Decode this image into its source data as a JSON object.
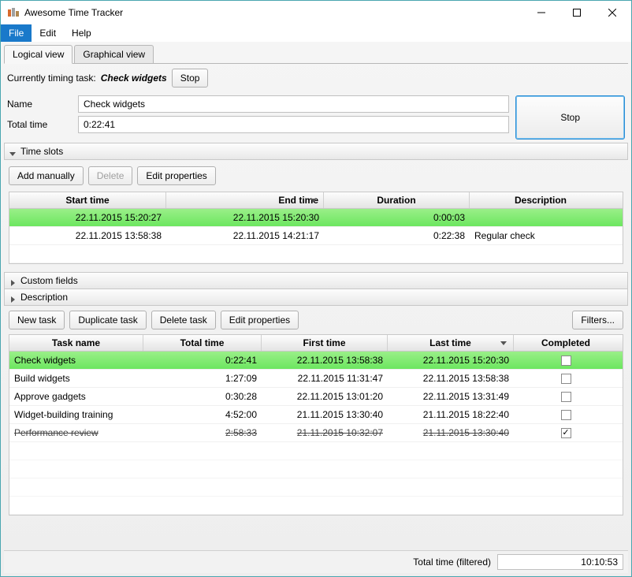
{
  "window": {
    "title": "Awesome Time Tracker"
  },
  "menubar": {
    "items": [
      {
        "label": "File",
        "active": true
      },
      {
        "label": "Edit",
        "active": false
      },
      {
        "label": "Help",
        "active": false
      }
    ]
  },
  "tabs": {
    "items": [
      {
        "label": "Logical view",
        "active": true
      },
      {
        "label": "Graphical view",
        "active": false
      }
    ]
  },
  "timing": {
    "prefix": "Currently timing task:",
    "task": "Check widgets",
    "stop_label": "Stop"
  },
  "form": {
    "name_label": "Name",
    "name_value": "Check widgets",
    "total_label": "Total time",
    "total_value": "0:22:41",
    "big_stop_label": "Stop"
  },
  "expanders": {
    "time_slots": "Time slots",
    "custom_fields": "Custom fields",
    "description": "Description"
  },
  "slots_toolbar": {
    "add_manually": "Add manually",
    "delete": "Delete",
    "edit_properties": "Edit properties"
  },
  "slots_table": {
    "headers": {
      "start": "Start time",
      "end": "End time",
      "duration": "Duration",
      "description": "Description"
    },
    "rows": [
      {
        "start": "22.11.2015 15:20:27",
        "end": "22.11.2015 15:20:30",
        "duration": "0:00:03",
        "description": "",
        "selected": true
      },
      {
        "start": "22.11.2015 13:58:38",
        "end": "22.11.2015 14:21:17",
        "duration": "0:22:38",
        "description": "Regular check",
        "selected": false
      }
    ]
  },
  "tasks_toolbar": {
    "new_task": "New task",
    "duplicate_task": "Duplicate task",
    "delete_task": "Delete task",
    "edit_properties": "Edit properties",
    "filters": "Filters..."
  },
  "tasks_table": {
    "headers": {
      "name": "Task name",
      "total": "Total time",
      "first": "First time",
      "last": "Last time",
      "completed": "Completed"
    },
    "rows": [
      {
        "name": "Check widgets",
        "total": "0:22:41",
        "first": "22.11.2015 13:58:38",
        "last": "22.11.2015 15:20:30",
        "completed": false,
        "selected": true,
        "strike": false
      },
      {
        "name": "Build widgets",
        "total": "1:27:09",
        "first": "22.11.2015 11:31:47",
        "last": "22.11.2015 13:58:38",
        "completed": false,
        "selected": false,
        "strike": false
      },
      {
        "name": "Approve gadgets",
        "total": "0:30:28",
        "first": "22.11.2015 13:01:20",
        "last": "22.11.2015 13:31:49",
        "completed": false,
        "selected": false,
        "strike": false
      },
      {
        "name": "Widget-building training",
        "total": "4:52:00",
        "first": "21.11.2015 13:30:40",
        "last": "21.11.2015 18:22:40",
        "completed": false,
        "selected": false,
        "strike": false
      },
      {
        "name": "Performance review",
        "total": "2:58:33",
        "first": "21.11.2015 10:32:07",
        "last": "21.11.2015 13:30:40",
        "completed": true,
        "selected": false,
        "strike": true
      }
    ]
  },
  "status": {
    "label": "Total time (filtered)",
    "value": "10:10:53"
  }
}
